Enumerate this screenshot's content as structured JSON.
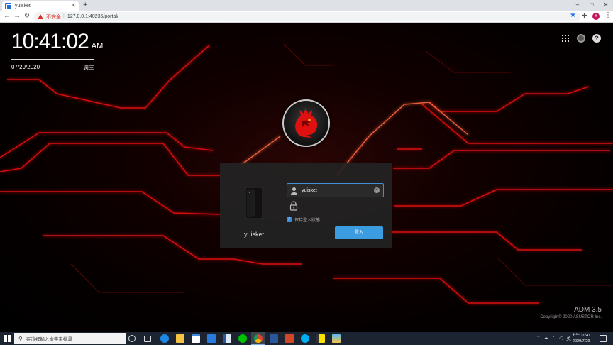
{
  "browser": {
    "tab_title": "yuisket",
    "new_tab_label": "+",
    "security_warning": "不安全",
    "url": "127.0.0.1:40235/portal/",
    "profile_initial": "Y",
    "window_controls": [
      "–",
      "□",
      "✕"
    ]
  },
  "clock": {
    "time": "10:41:02",
    "ampm": "AM",
    "date": "07/29/2020",
    "weekday": "週三"
  },
  "login": {
    "device_name": "yuisket",
    "username": "yuisket",
    "remember_label": "保持登入狀態",
    "remember_checked": true,
    "login_button": "登入"
  },
  "brand": {
    "version": "ADM 3.5",
    "copyright": "Copyright© 2020 ASUSTOR Inc."
  },
  "taskbar": {
    "search_placeholder": "在這裡輸入文字來搜尋",
    "clock_time": "上午 10:41",
    "clock_date": "2020/7/29",
    "ime_label": "英",
    "pinned_icons": [
      "cortana-icon",
      "task-view-icon",
      "edge-icon",
      "file-explorer-icon",
      "store-icon",
      "mail-icon",
      "word-doc-icon",
      "line-icon",
      "chrome-icon",
      "word-icon",
      "powerpoint-icon",
      "skype-icon",
      "sticky-notes-icon",
      "photos-icon"
    ]
  },
  "colors": {
    "accent": "#3b9ce0",
    "circuit_red": "#e01010",
    "taskbar_bg": "#1b2430"
  }
}
